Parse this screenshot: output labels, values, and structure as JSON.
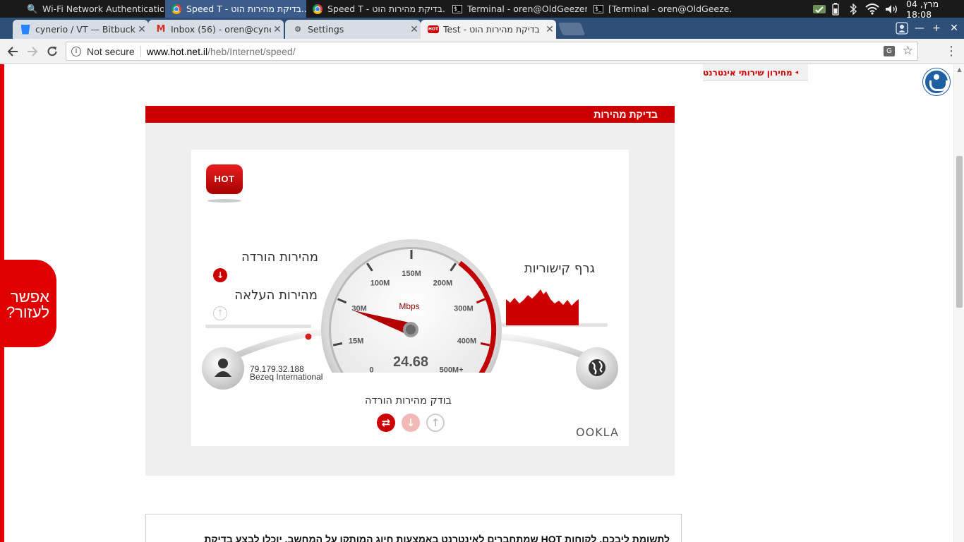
{
  "taskbar": {
    "windows": [
      {
        "label": "Wi-Fi Network Authenticatio...",
        "icon": "key-icon"
      },
      {
        "label": "Speed T - בדיקת מהירות הוט...",
        "icon": "chrome-icon",
        "active": true
      },
      {
        "label": "Speed T - בדיקת מהירות הוט...",
        "icon": "chrome-icon"
      },
      {
        "label": "Terminal - oren@OldGeezer: ~",
        "icon": "terminal-icon"
      },
      {
        "label": "[Terminal - oren@OldGeeze...",
        "icon": "terminal-icon"
      }
    ],
    "clock": "04 מרץ, 18:08"
  },
  "tabs": [
    {
      "label": "cynerio / VT — Bitbucket",
      "icon": "bitbucket-icon"
    },
    {
      "label": "Inbox (56) - oren@cynerio",
      "icon": "gmail-icon"
    },
    {
      "label": "Settings",
      "icon": "gear-icon"
    },
    {
      "label": "Test - בדיקת מהירות הוט",
      "icon": "hot-icon",
      "active": true
    }
  ],
  "omnibox": {
    "security": "Not secure",
    "host": "www.hot.net.il",
    "path": "/heb/Internet/speed/"
  },
  "page": {
    "internet_prices_link": "מחירון שירותי אינטרנט",
    "help_tab": "אפשר לעזור?",
    "section_title": "בדיקת מהירות",
    "bottom_text": "לתשומת ליבכם, לקוחות HOT שמתחברים לאינטרנט באמצעות חיוג המותקן על המחשב, יוכלו לבצע בדיקת"
  },
  "speedtest": {
    "logo_text": "HOT",
    "download_label": "מהירות הורדה",
    "upload_label": "מהירות העלאה",
    "graph_label": "גרף קישוריות",
    "status": "בודק מהירות הורדה",
    "client_ip": "79.179.32.188",
    "client_isp": "Bezeq International",
    "brand": "OOKLA",
    "gauge": {
      "unit": "Mbps",
      "reading": "24.68",
      "ticks": [
        "0",
        "15M",
        "30M",
        "100M",
        "150M",
        "200M",
        "300M",
        "400M",
        "500M+"
      ]
    }
  },
  "colors": {
    "accent": "#cd0000",
    "tab_strip": "#2d4f78",
    "taskbar_active": "#3c5d8c"
  }
}
